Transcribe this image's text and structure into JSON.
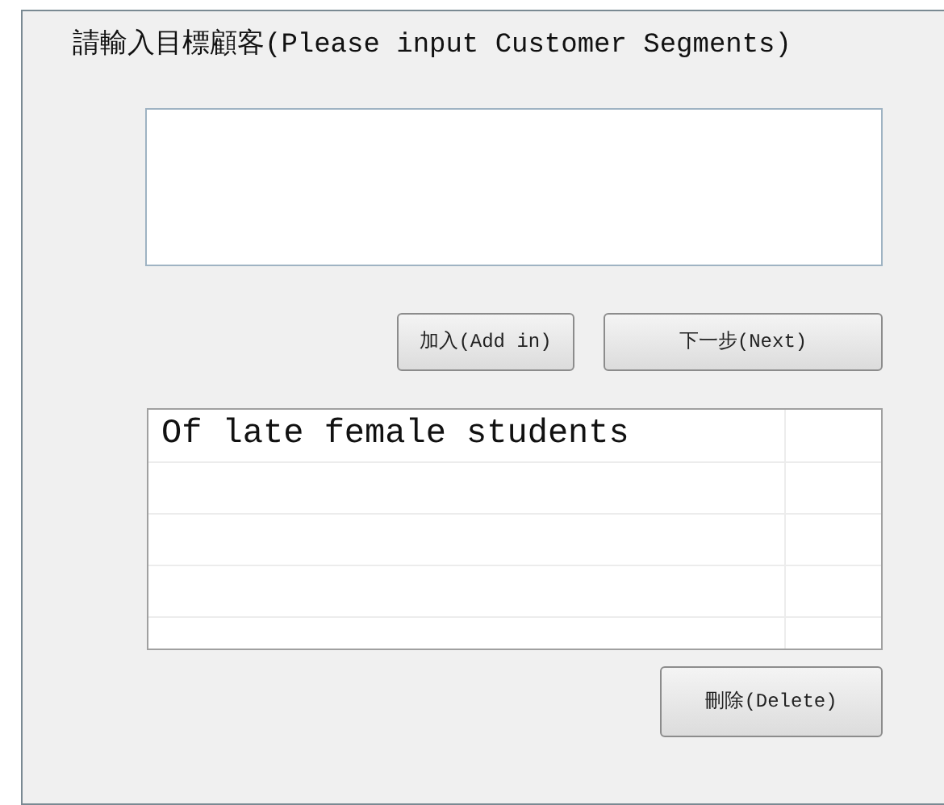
{
  "prompt": "請輸入目標顧客(Please input Customer Segments)",
  "buttons": [
    {
      "label": "加入(Add in)"
    },
    {
      "label": "下一步(Next)"
    }
  ],
  "list": {
    "items": [
      {
        "text": "Of late female students"
      }
    ]
  },
  "delete_button": {
    "label": "刪除(Delete)"
  }
}
